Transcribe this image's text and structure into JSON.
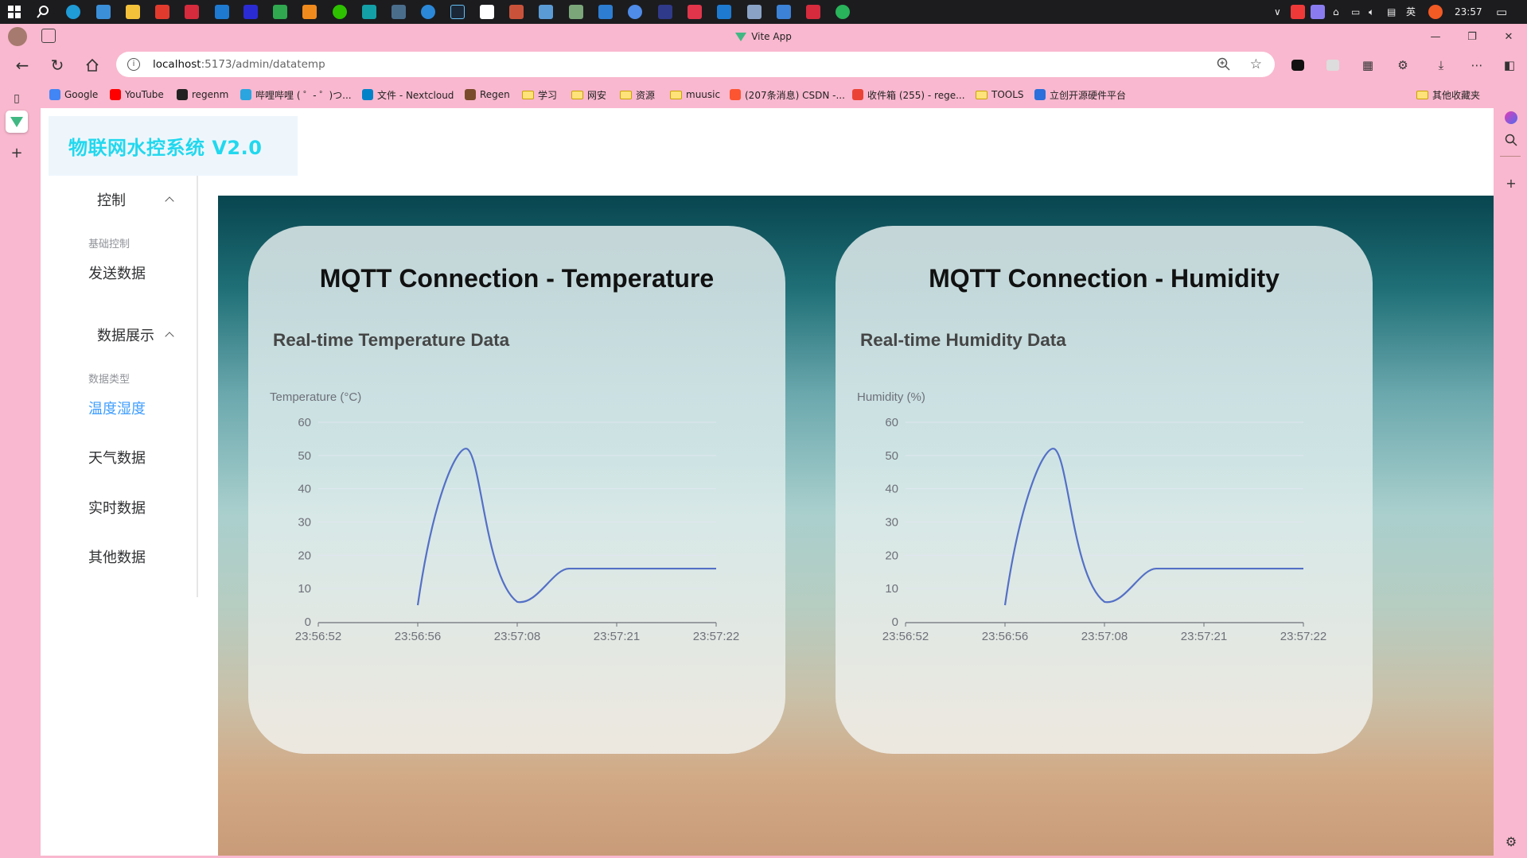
{
  "taskbar": {
    "time": "23:57",
    "ime": "英"
  },
  "browser": {
    "tab_title": "Vite App",
    "url_host": "localhost",
    "url_rest": ":5173/admin/datatemp",
    "bookmarks": [
      {
        "label": "Google",
        "color": "#4285f4"
      },
      {
        "label": "YouTube",
        "color": "#ff0000"
      },
      {
        "label": "regenm",
        "color": "#222222"
      },
      {
        "label": "哔哩哔哩 ( ゜- ゜)つ...",
        "color": "#2aa5df"
      },
      {
        "label": "文件 - Nextcloud",
        "color": "#0082c9"
      },
      {
        "label": "Regen",
        "color": "#7a4b2a"
      },
      {
        "label": "学习",
        "folder": true
      },
      {
        "label": "网安",
        "folder": true
      },
      {
        "label": "资源",
        "folder": true
      },
      {
        "label": "muusic",
        "folder": true
      },
      {
        "label": "(207条消息) CSDN -...",
        "color": "#fc5531"
      },
      {
        "label": "收件箱 (255) - rege...",
        "color": "#ea4335"
      },
      {
        "label": "TOOLS",
        "folder": true
      },
      {
        "label": "立创开源硬件平台",
        "color": "#2a6fdb"
      }
    ],
    "other_bookmarks": "其他收藏夹"
  },
  "app": {
    "logo": "物联网水控系统 V2.0",
    "menu": {
      "group_control": "控制",
      "cat_basic": "基础控制",
      "item_send": "发送数据",
      "group_display": "数据展示",
      "cat_type": "数据类型",
      "item_temp_hum": "温度湿度",
      "item_weather": "天气数据",
      "item_realtime": "实时数据",
      "item_other": "其他数据"
    }
  },
  "cards": {
    "temp": {
      "heading": "MQTT Connection - Temperature",
      "chart_title": "Real-time Temperature Data"
    },
    "hum": {
      "heading": "MQTT Connection - Humidity",
      "chart_title": "Real-time Humidity Data"
    }
  },
  "chart_data": [
    {
      "type": "line",
      "title": "Real-time Temperature Data",
      "ylabel": "Temperature (°C)",
      "x": [
        "23:56:52",
        "23:56:56",
        "23:57:08",
        "23:57:21",
        "23:57:22"
      ],
      "series": [
        {
          "values": [
            null,
            5,
            6,
            16,
            16
          ]
        }
      ],
      "ylim": [
        0,
        60
      ],
      "yticks": [
        0,
        10,
        20,
        30,
        40,
        50,
        60
      ],
      "smooth": true,
      "color": "#5470c6",
      "grid": true
    },
    {
      "type": "line",
      "title": "Real-time Humidity Data",
      "ylabel": "Humidity (%)",
      "x": [
        "23:56:52",
        "23:56:56",
        "23:57:08",
        "23:57:21",
        "23:57:22"
      ],
      "series": [
        {
          "values": [
            null,
            5,
            6,
            16,
            16
          ]
        }
      ],
      "ylim": [
        0,
        60
      ],
      "yticks": [
        0,
        10,
        20,
        30,
        40,
        50,
        60
      ],
      "smooth": true,
      "color": "#5470c6",
      "grid": true
    }
  ]
}
